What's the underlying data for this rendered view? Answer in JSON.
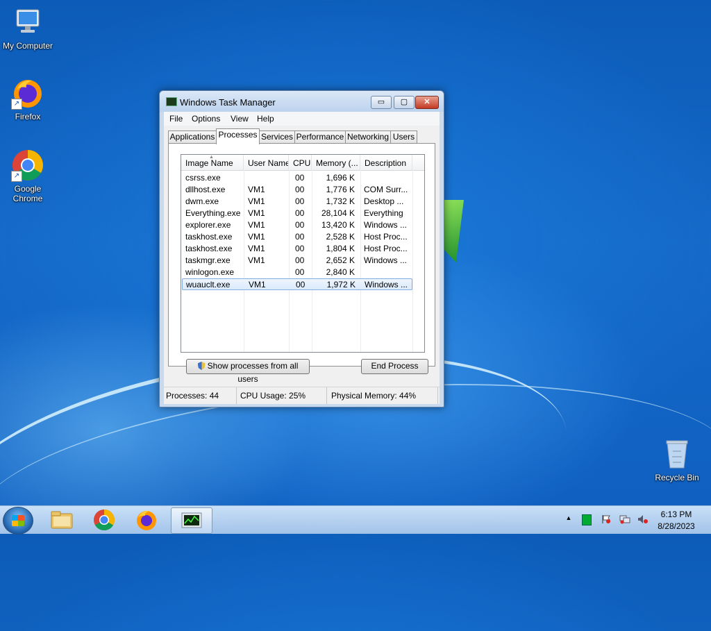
{
  "desktop": {
    "icons": [
      {
        "label": "My Computer"
      },
      {
        "label": "Firefox"
      },
      {
        "label": "Google Chrome"
      },
      {
        "label": "Recycle Bin"
      }
    ]
  },
  "window": {
    "title": "Windows Task Manager",
    "menus": [
      "File",
      "Options",
      "View",
      "Help"
    ],
    "tabs": [
      "Applications",
      "Processes",
      "Services",
      "Performance",
      "Networking",
      "Users"
    ],
    "active_tab": "Processes",
    "columns": [
      "Image Name",
      "User Name",
      "CPU",
      "Memory (...",
      "Description"
    ],
    "rows": [
      {
        "image": "csrss.exe",
        "user": "",
        "cpu": "00",
        "memory": "1,696 K",
        "description": ""
      },
      {
        "image": "dllhost.exe",
        "user": "VM1",
        "cpu": "00",
        "memory": "1,776 K",
        "description": "COM Surr..."
      },
      {
        "image": "dwm.exe",
        "user": "VM1",
        "cpu": "00",
        "memory": "1,732 K",
        "description": "Desktop ..."
      },
      {
        "image": "Everything.exe",
        "user": "VM1",
        "cpu": "00",
        "memory": "28,104 K",
        "description": "Everything"
      },
      {
        "image": "explorer.exe",
        "user": "VM1",
        "cpu": "00",
        "memory": "13,420 K",
        "description": "Windows ..."
      },
      {
        "image": "taskhost.exe",
        "user": "VM1",
        "cpu": "00",
        "memory": "2,528 K",
        "description": "Host Proc..."
      },
      {
        "image": "taskhost.exe",
        "user": "VM1",
        "cpu": "00",
        "memory": "1,804 K",
        "description": "Host Proc..."
      },
      {
        "image": "taskmgr.exe",
        "user": "VM1",
        "cpu": "00",
        "memory": "2,652 K",
        "description": "Windows ..."
      },
      {
        "image": "winlogon.exe",
        "user": "",
        "cpu": "00",
        "memory": "2,840 K",
        "description": ""
      },
      {
        "image": "wuauclt.exe",
        "user": "VM1",
        "cpu": "00",
        "memory": "1,972 K",
        "description": "Windows ..."
      }
    ],
    "selected_row": 9,
    "show_all_button": "Show processes from all users",
    "end_process_button": "End Process",
    "status": {
      "processes": "Processes: 44",
      "cpu": "CPU Usage: 25%",
      "memory": "Physical Memory: 44%"
    },
    "buttons": {
      "minimize": "▭",
      "maximize": "▢",
      "close": "✕"
    }
  },
  "taskbar": {
    "clock_time": "6:13 PM",
    "clock_date": "8/28/2023",
    "tray_arrow": "▲"
  },
  "colors": {
    "desktop_blue": "#1569c7",
    "selection": "#dbeafc",
    "close_red": "#c53a24"
  }
}
